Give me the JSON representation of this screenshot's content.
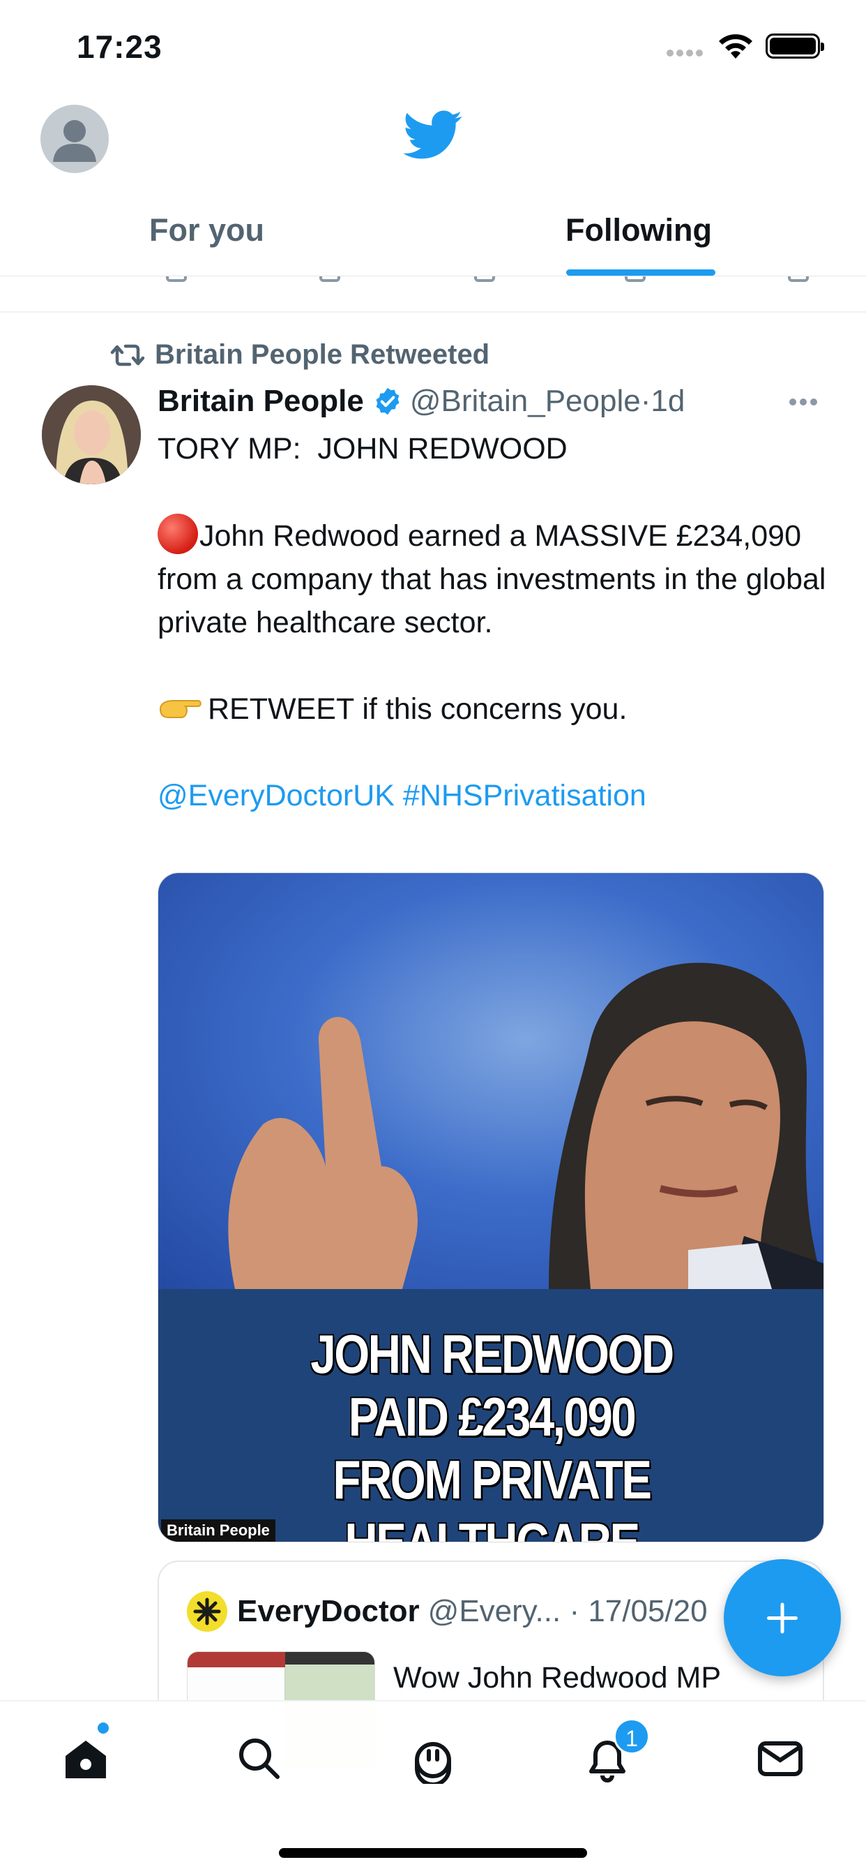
{
  "status_bar": {
    "time": "17:23"
  },
  "header": {
    "logo_icon": "twitter-bird-icon",
    "tabs": [
      {
        "label": "For you",
        "active": false
      },
      {
        "label": "Following",
        "active": true
      }
    ]
  },
  "tweet": {
    "retweeted_by": "Britain People Retweeted",
    "author_name": "Britain People",
    "author_handle": "@Britain_People",
    "time_sep": " · ",
    "time": "1d",
    "line1": "TORY MP:  JOHN REDWOOD",
    "para2": "John Redwood earned a MASSIVE £234,090 from a company that has investments in the global private healthcare sector.",
    "para3": "RETWEET if this concerns you.",
    "mention": "@EveryDoctorUK",
    "hashtag": "#NHSPrivatisation",
    "media": {
      "caption_lines": [
        "JOHN REDWOOD",
        "PAID £234,090",
        "FROM PRIVATE HEALTHCARE"
      ],
      "watermark": "Britain People"
    },
    "quote": {
      "name": "EveryDoctor",
      "handle": "@Every... · 17/05/20",
      "text": "Wow John Redwood MP"
    }
  },
  "tabbar": {
    "items": [
      "home-icon",
      "search-icon",
      "spaces-icon",
      "notifications-icon",
      "messages-icon"
    ],
    "notifications_badge": "1"
  },
  "colors": {
    "accent": "#1d9bf0",
    "text": "#0f1419",
    "muted": "#536471"
  }
}
